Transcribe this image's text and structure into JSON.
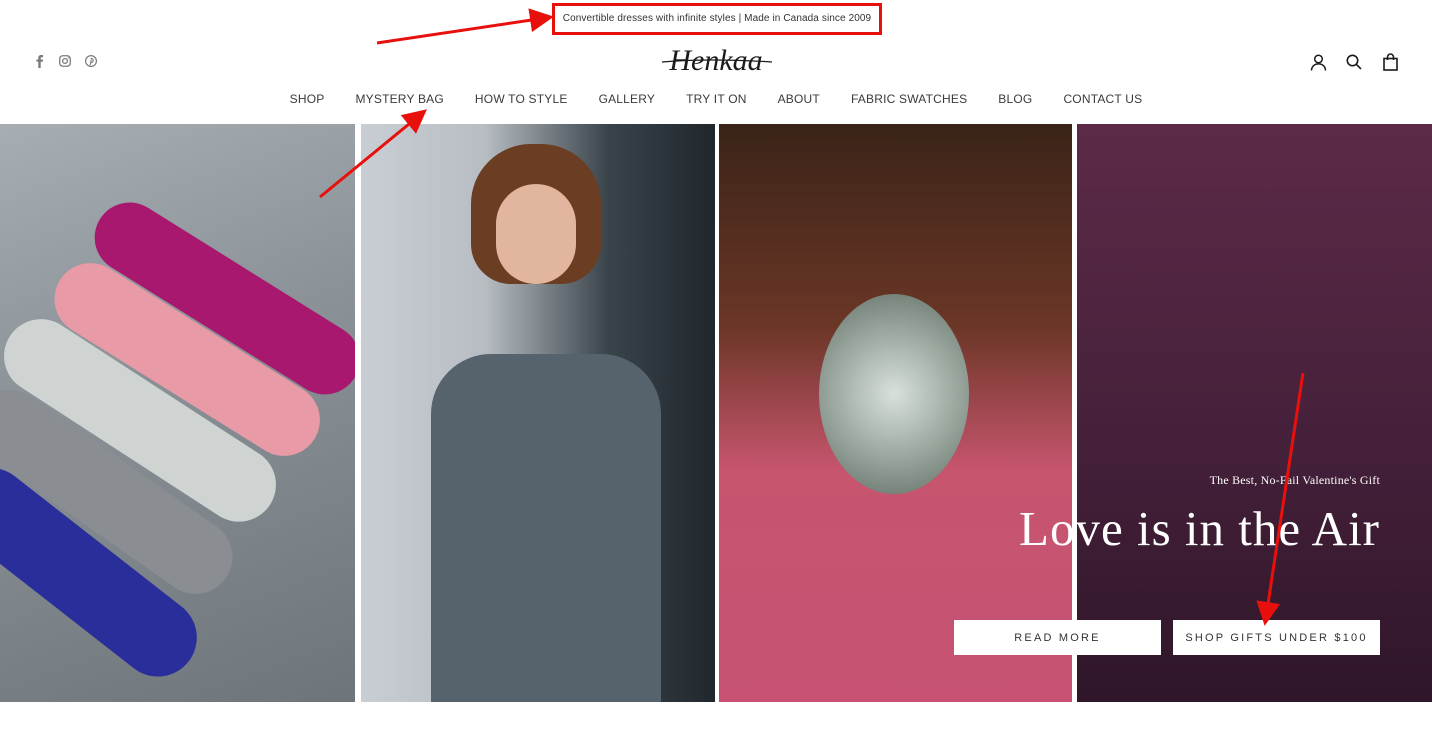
{
  "announcement": "Convertible dresses with infinite styles | Made in Canada since 2009",
  "social": {
    "facebook": "facebook-icon",
    "instagram": "instagram-icon",
    "pinterest": "pinterest-icon"
  },
  "brand": {
    "logo_text": "Henkaa"
  },
  "header_icons": {
    "account": "account-icon",
    "search": "search-icon",
    "cart": "cart-icon"
  },
  "nav": {
    "items": [
      "SHOP",
      "MYSTERY BAG",
      "HOW TO STYLE",
      "GALLERY",
      "TRY IT ON",
      "ABOUT",
      "FABRIC SWATCHES",
      "BLOG",
      "CONTACT US"
    ]
  },
  "hero": {
    "subtitle": "The Best, No-Fail Valentine's Gift",
    "title": "Love is in the Air",
    "button_read_more": "READ MORE",
    "button_shop": "SHOP GIFTS UNDER $100"
  },
  "colors": {
    "annotation_red": "#e8100d",
    "hero_purple": "#45203a",
    "dress_pink": "#c65173"
  }
}
